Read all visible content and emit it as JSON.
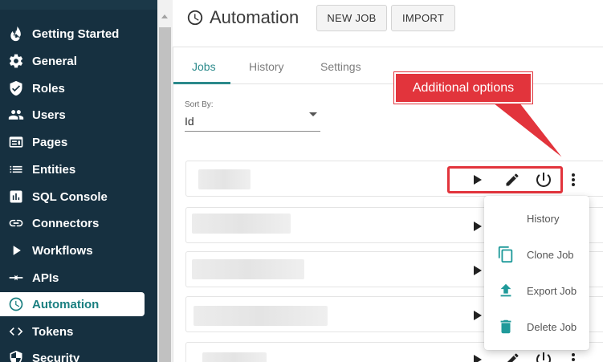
{
  "sidebar": {
    "items": [
      {
        "label": "Getting Started",
        "icon": "flame-icon",
        "active": false
      },
      {
        "label": "General",
        "icon": "gear-icon",
        "active": false
      },
      {
        "label": "Roles",
        "icon": "shield-check-icon",
        "active": false
      },
      {
        "label": "Users",
        "icon": "users-icon",
        "active": false
      },
      {
        "label": "Pages",
        "icon": "pages-icon",
        "active": false
      },
      {
        "label": "Entities",
        "icon": "list-icon",
        "active": false
      },
      {
        "label": "SQL Console",
        "icon": "chart-box-icon",
        "active": false
      },
      {
        "label": "Connectors",
        "icon": "link-icon",
        "active": false
      },
      {
        "label": "Workflows",
        "icon": "play-icon",
        "active": false
      },
      {
        "label": "APIs",
        "icon": "arrows-icon",
        "active": false
      },
      {
        "label": "Automation",
        "icon": "clock-icon",
        "active": true
      },
      {
        "label": "Tokens",
        "icon": "code-icon",
        "active": false
      },
      {
        "label": "Security",
        "icon": "security-icon",
        "active": false
      }
    ]
  },
  "header": {
    "title": "Automation",
    "new_job_label": "NEW JOB",
    "import_label": "IMPORT"
  },
  "tabs": [
    {
      "label": "Jobs",
      "active": true
    },
    {
      "label": "History",
      "active": false
    },
    {
      "label": "Settings",
      "active": false
    }
  ],
  "sort": {
    "label": "Sort By:",
    "value": "Id"
  },
  "annotation": {
    "text": "Additional options",
    "color": "#e2343c"
  },
  "menu": {
    "items": [
      {
        "label": "History",
        "icon": ""
      },
      {
        "label": "Clone Job",
        "icon": "copy-icon"
      },
      {
        "label": "Export Job",
        "icon": "upload-icon"
      },
      {
        "label": "Delete Job",
        "icon": "trash-icon"
      }
    ]
  },
  "colors": {
    "sidebar_bg": "#163040",
    "accent": "#2b8a8b",
    "menu_icon": "#1f9a9a"
  }
}
